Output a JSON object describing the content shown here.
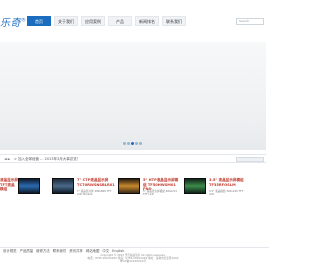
{
  "header": {
    "logo_text": "乐奇",
    "logo_mark": "®",
    "nav": [
      {
        "label": "首页",
        "active": true
      },
      {
        "label": "关于我们",
        "active": false
      },
      {
        "label": "应用案例",
        "active": false
      },
      {
        "label": "产品",
        "active": false
      },
      {
        "label": "新闻排名",
        "active": false
      },
      {
        "label": "联系我们",
        "active": false
      }
    ],
    "search_placeholder": "Search"
  },
  "banner": {
    "dots": [
      false,
      false,
      true,
      false,
      false
    ]
  },
  "news": {
    "arrows": "◄ ►",
    "text": "> 加入全球经营 ... 2013年3月大事总览！"
  },
  "products": [
    {
      "title": "液晶显示屏 TFT液晶模组",
      "desc": ""
    },
    {
      "title": "7\" CTP液晶显示屏 TC70RWSNSBLR01",
      "desc": "7\" 液晶显示屏 480x800 TFT LCD Module"
    },
    {
      "title": "5\" HTP液晶显示屏模组 TF50HWSM01 FNO",
      "desc": "5\" 液晶显示屏模组 480x272 TFT LCD"
    },
    {
      "title": "3.5\" 液晶显示屏模组 TF35RFOSLM",
      "desc": "3.5\" 液晶模组 320x240 TFT LCD"
    }
  ],
  "footer": {
    "links": [
      "设计规范",
      "产品质量",
      "维修方法",
      "联系我们",
      "资讯共享",
      "网站地图",
      "中文",
      "English"
    ],
    "copyright_1": "Copyright © 2013 乐奇液晶显示 All rights reserved.",
    "copyright_2": "电话：0755-XXXXXXXX  传真：0755-XXXXXXXX  地址：深圳市宝安区XXXX",
    "copyright_3": "粤ICP备XXXXXXXX号"
  }
}
